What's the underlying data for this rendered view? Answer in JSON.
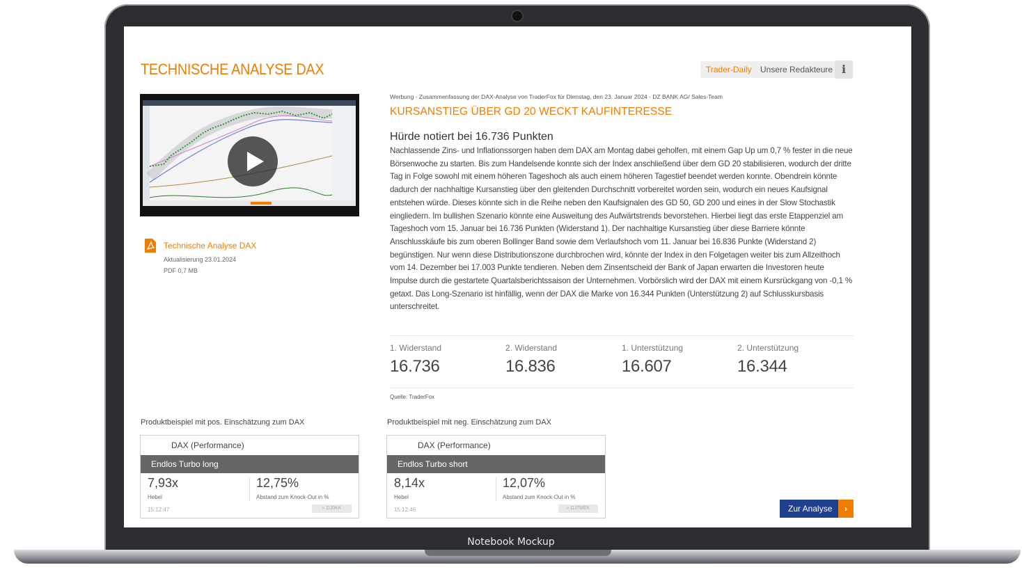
{
  "page": {
    "title": "TECHNISCHE ANALYSE DAX",
    "buttons": {
      "trader_daily": "Trader-Daily",
      "redakteure": "Unsere Redakteure",
      "info": "i"
    }
  },
  "pdf": {
    "link": "Technische Analyse DAX",
    "updated": "Aktualisierung 23.01.2024",
    "size": "PDF 0,7 MB"
  },
  "article": {
    "werbung": "Werbung - Zusammenfassung der DAX-Analyse von TraderFox für Dienstag, den 23. Januar 2024 - DZ BANK AG/ Sales-Team",
    "headline": "KURSANSTIEG ÜBER GD 20 WECKT KAUFINTERESSE",
    "subhead": "Hürde notiert bei 16.736 Punkten",
    "body": "Nachlassende Zins- und Inflationssorgen haben dem DAX am Montag dabei geholfen, mit einem Gap Up um 0,7 % fester in die neue Börsenwoche zu starten. Bis zum Handelsende konnte sich der Index anschließend über dem GD 20 stabilisieren, wodurch der dritte Tag in Folge sowohl mit einem höheren Tageshoch als auch einem höheren Tagestief beendet werden konnte. Obendrein könnte dadurch der nachhaltige Kursanstieg über den gleitenden Durchschnitt vorbereitet worden sein, wodurch ein neues Kaufsignal entstehen würde. Dieses könnte sich in die Reihe neben den Kaufsignalen des GD 50, GD 200 und eines in der Slow Stochastik eingliedern. Im bullishen Szenario könnte eine Ausweitung des Aufwärtstrends bevorstehen. Hierbei liegt das erste Etappenziel am Tageshoch vom 15. Januar bei 16.736 Punkten (Widerstand 1). Der nachhaltige Kursanstieg über diese Barriere könnte Anschlusskäufe bis zum oberen Bollinger Band sowie dem Verlaufshoch vom 11. Januar bei 16.836 Punkte (Widerstand 2) begünstigen. Nur wenn diese Distributionszone durchbrochen wird, könnte der Index in den Folgetagen weiter bis zum Allzeithoch vom 14. Dezember bei 17.003 Punkte tendieren. Neben dem Zinsentscheid der Bank of Japan erwarten die Investoren heute Impulse durch die gestartete Quartalsberichtssaison der Unternehmen. Vorbörslich wird der DAX mit einem Kursrückgang von -0,1 % getaxt. Das Long-Szenario ist hinfällig, wenn der DAX die Marke von 16.344 Punkten (Unterstützung 2) auf Schlusskursbasis unterschreitet."
  },
  "levels": [
    {
      "label": "1. Widerstand",
      "value": "16.736"
    },
    {
      "label": "2. Widerstand",
      "value": "16.836"
    },
    {
      "label": "1. Unterstützung",
      "value": "16.607"
    },
    {
      "label": "2. Unterstützung",
      "value": "16.344"
    }
  ],
  "source": "Quelle: TraderFox",
  "products": [
    {
      "title": "Produktbeispiel mit pos. Einschätzung zum DAX",
      "underlying": "DAX (Performance)",
      "type": "Endlos Turbo long",
      "leverage": "7,93x",
      "leverage_label": "Hebel",
      "distance": "12,75%",
      "distance_label": "Abstand zum Knock-Out in %",
      "time": "15:12:47",
      "wkn": "DJ0KK"
    },
    {
      "title": "Produktbeispiel mit neg. Einschätzung zum DAX",
      "underlying": "DAX (Performance)",
      "type": "Endlos Turbo short",
      "leverage": "8,14x",
      "leverage_label": "Hebel",
      "distance": "12,07%",
      "distance_label": "Abstand zum Knock-Out in %",
      "time": "15:12:46",
      "wkn": "DJ7MEK"
    }
  ],
  "cta": {
    "label": "Zur Analyse",
    "arrow": "›"
  },
  "mockup_label": "Notebook Mockup",
  "colors": {
    "accent": "#ef7d00",
    "cta": "#1f3f8f",
    "bar": "#666666"
  }
}
